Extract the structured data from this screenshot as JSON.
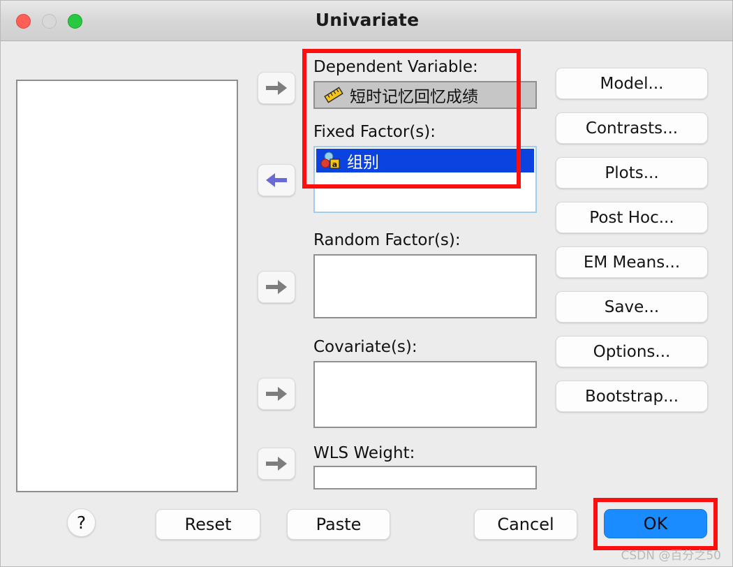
{
  "window": {
    "title": "Univariate",
    "traffic_lights": [
      "close-button",
      "minimize-button",
      "zoom-button"
    ]
  },
  "source_list": {
    "name": "source-variable-list",
    "items": []
  },
  "transfer_buttons": [
    {
      "name": "move-to-dependent-variable",
      "icon": "arrow-right-icon",
      "state": "inactive"
    },
    {
      "name": "move-to-fixed-factors",
      "icon": "arrow-left-icon",
      "state": "active"
    },
    {
      "name": "move-to-random-factors",
      "icon": "arrow-right-icon",
      "state": "inactive"
    },
    {
      "name": "move-to-covariates",
      "icon": "arrow-right-icon",
      "state": "inactive"
    },
    {
      "name": "move-to-wls-weight",
      "icon": "arrow-right-icon",
      "state": "inactive"
    }
  ],
  "fields": {
    "dependent": {
      "label": "Dependent Variable:",
      "value": "短时记忆回忆成绩",
      "icon": "scale-ruler-icon"
    },
    "fixed_factors": {
      "label": "Fixed Factor(s):",
      "items": [
        {
          "text": "组别",
          "icon": "nominal-string-icon",
          "selected": true
        }
      ]
    },
    "random_factors": {
      "label": "Random Factor(s):",
      "items": []
    },
    "covariates": {
      "label": "Covariate(s):",
      "items": []
    },
    "wls_weight": {
      "label": "WLS Weight:",
      "value": ""
    }
  },
  "command_buttons": [
    {
      "label": "Model...",
      "name": "model-button"
    },
    {
      "label": "Contrasts...",
      "name": "contrasts-button"
    },
    {
      "label": "Plots...",
      "name": "plots-button"
    },
    {
      "label": "Post Hoc...",
      "name": "post-hoc-button"
    },
    {
      "label": "EM Means...",
      "name": "em-means-button"
    },
    {
      "label": "Save...",
      "name": "save-button"
    },
    {
      "label": "Options...",
      "name": "options-button"
    },
    {
      "label": "Bootstrap...",
      "name": "bootstrap-button"
    }
  ],
  "bottom_buttons": {
    "help": "?",
    "reset": "Reset",
    "paste": "Paste",
    "cancel": "Cancel",
    "ok": "OK"
  },
  "annotations": [
    {
      "name": "highlight-variable-assignment",
      "color": "#fb0f0f"
    },
    {
      "name": "highlight-ok-button",
      "color": "#fb0f0f"
    }
  ],
  "watermark": "CSDN @百分之50",
  "colors": {
    "accent_ok": "#1a8cff",
    "selection": "#0a43e0",
    "annotation": "#fb0f0f",
    "window_bg": "#ececec"
  }
}
